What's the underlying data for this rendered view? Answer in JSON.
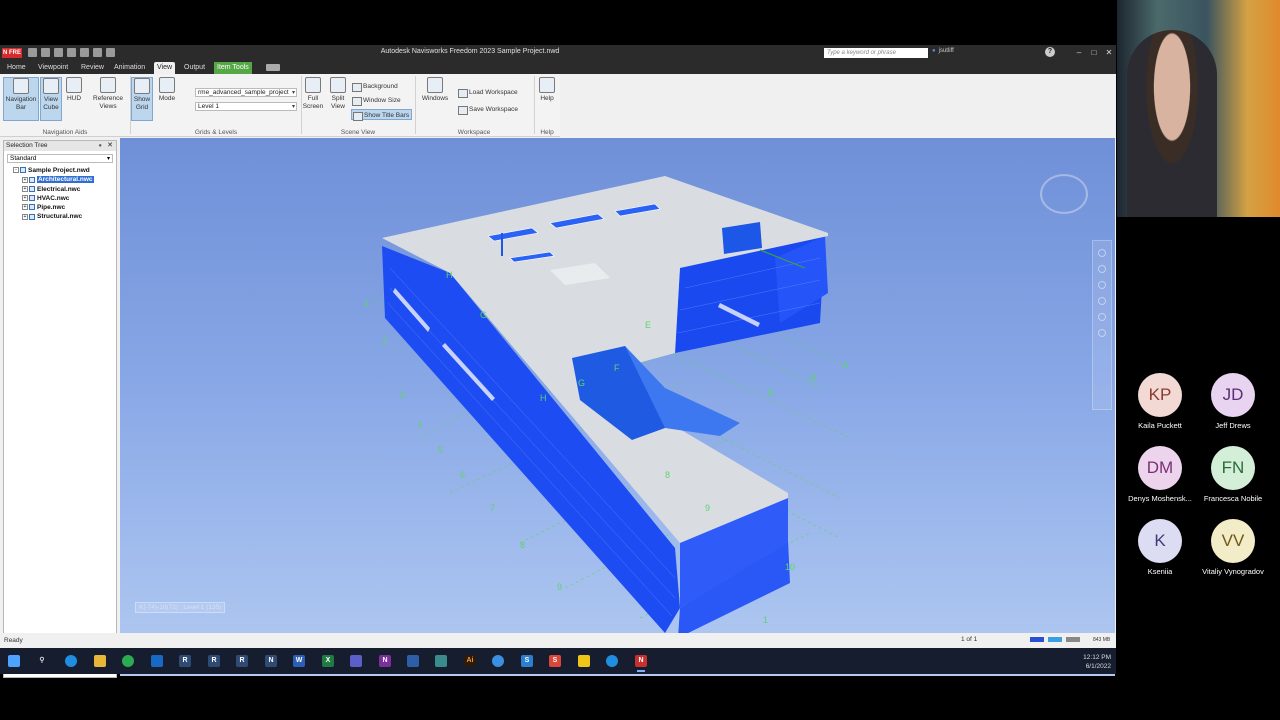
{
  "app": {
    "badge": "N FRE",
    "title": "Autodesk Navisworks Freedom 2023   Sample Project.nwd",
    "search_placeholder": "Type a keyword or phrase",
    "user": "jsutliff"
  },
  "menu": {
    "tabs": [
      "Home",
      "Viewpoint",
      "Review",
      "Animation",
      "View",
      "Output",
      "Item Tools"
    ],
    "active": "View"
  },
  "ribbon": {
    "navigation_bar": "Navigation\nBar",
    "view_cube": "View\nCube",
    "hud": "HUD",
    "reference_views": "Reference\nViews",
    "show_grid": "Show\nGrid",
    "mode": "Mode",
    "grid_combo": "rme_advanced_sample_project",
    "level_combo": "Level 1",
    "full_screen": "Full\nScreen",
    "split_view": "Split\nView",
    "background": "Background",
    "window_size": "Window Size",
    "show_title_bars": "Show Title Bars",
    "windows": "Windows",
    "load_workspace": "Load Workspace",
    "save_workspace": "Save Workspace",
    "help": "Help",
    "groups": {
      "navigation_aids": "Navigation Aids",
      "grids_levels": "Grids & Levels",
      "scene_view": "Scene View",
      "workspace": "Workspace",
      "help": "Help"
    }
  },
  "selection_tree": {
    "title": "Selection Tree",
    "mode": "Standard",
    "root": "Sample Project.nwd",
    "items": [
      "Architectural.nwc",
      "Electrical.nwc",
      "HVAC.nwc",
      "Pipe.nwc",
      "Structural.nwc"
    ],
    "selected": "Architectural.nwc"
  },
  "viewport": {
    "coordinate_readout": "K(-74)-10(72) : Level 1 (135)",
    "grid_labels_letters": [
      "H",
      "G",
      "F",
      "E",
      "D",
      "C",
      "B",
      "A",
      "K",
      "J"
    ],
    "grid_labels_numbers": [
      "1",
      "2",
      "3",
      "4",
      "5",
      "6",
      "7",
      "8",
      "9",
      "10"
    ]
  },
  "status": {
    "ready": "Ready",
    "pages": "1 of 1",
    "memory": "843 MB"
  },
  "taskbar": {
    "time": "12:12 PM",
    "date": "6/1/2022"
  },
  "participants": [
    {
      "initials": "KP",
      "name": "Kaila Puckett",
      "bg": "#f3d9d3",
      "fg": "#8a3b2d"
    },
    {
      "initials": "JD",
      "name": "Jeff Drews",
      "bg": "#e8d4f1",
      "fg": "#5d2d78"
    },
    {
      "initials": "DM",
      "name": "Denys Moshensk...",
      "bg": "#ecd5ec",
      "fg": "#7a2f77"
    },
    {
      "initials": "FN",
      "name": "Francesca Nobile",
      "bg": "#d3efd8",
      "fg": "#2c6b39"
    },
    {
      "initials": "K",
      "name": "Kseniia",
      "bg": "#dcdcf2",
      "fg": "#3c3c7a"
    },
    {
      "initials": "VV",
      "name": "Vitaliy Vynogradov",
      "bg": "#f3ecc8",
      "fg": "#6e5a12"
    }
  ]
}
